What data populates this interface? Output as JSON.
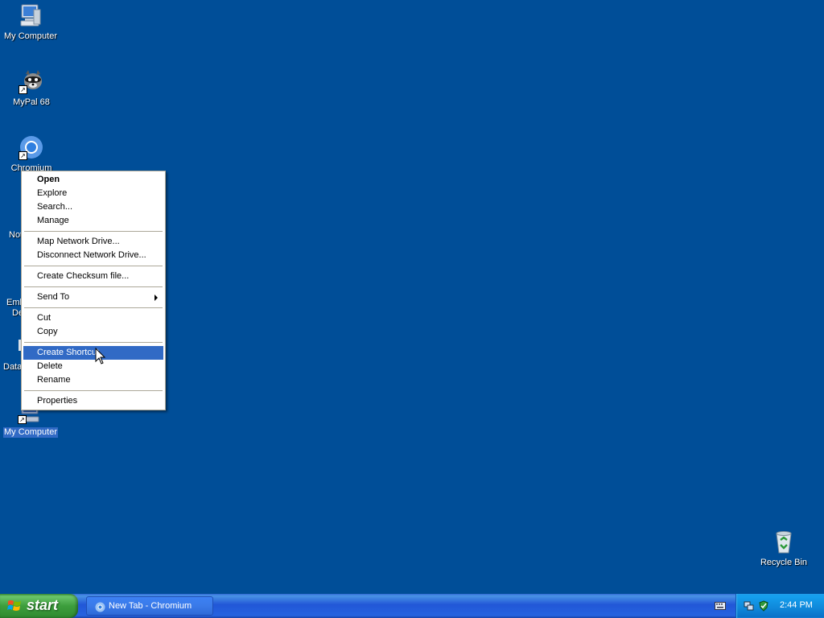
{
  "desktop": {
    "background_color": "#004E98",
    "icons": [
      {
        "label": "My Computer",
        "icon": "my-computer-icon"
      },
      {
        "label": "MyPal 68",
        "icon": "mypal-raccoon-icon"
      },
      {
        "label": "Chromium",
        "icon": "chromium-icon"
      },
      {
        "label": "Not",
        "icon": "notepad-icon"
      },
      {
        "label": "Emb",
        "label2": "De",
        "icon": "app-icon"
      },
      {
        "label": "Data",
        "icon": "database-icon"
      },
      {
        "label": "My Computer",
        "icon": "my-computer-icon"
      }
    ],
    "recycle_bin": {
      "label": "Recycle Bin",
      "icon": "recycle-bin-icon"
    }
  },
  "context_menu": {
    "groups": [
      [
        {
          "label": "Open",
          "bold": true
        },
        {
          "label": "Explore"
        },
        {
          "label": "Search..."
        },
        {
          "label": "Manage"
        }
      ],
      [
        {
          "label": "Map Network Drive..."
        },
        {
          "label": "Disconnect Network Drive..."
        }
      ],
      [
        {
          "label": "Create Checksum file..."
        }
      ],
      [
        {
          "label": "Send To",
          "submenu": true
        }
      ],
      [
        {
          "label": "Cut"
        },
        {
          "label": "Copy"
        }
      ],
      [
        {
          "label": "Create Shortcut",
          "highlighted": true
        },
        {
          "label": "Delete"
        },
        {
          "label": "Rename"
        }
      ],
      [
        {
          "label": "Properties"
        }
      ]
    ],
    "highlight_color": "#316AC5"
  },
  "taskbar": {
    "start_label": "start",
    "tasks": [
      {
        "label": "New Tab - Chromium",
        "icon": "chromium-icon"
      }
    ],
    "tray": {
      "icons": [
        "network-icon",
        "security-icon"
      ],
      "clock": "2:44 PM"
    }
  }
}
